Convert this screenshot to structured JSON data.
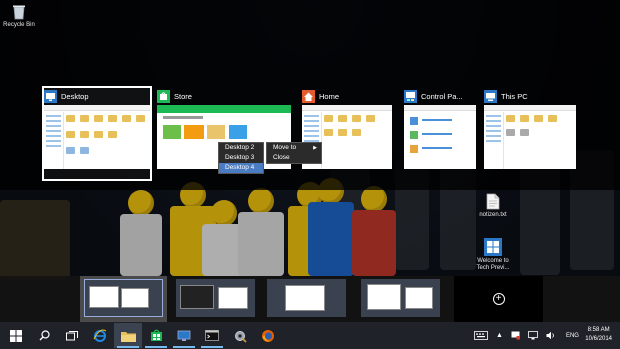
{
  "desktop_icons": [
    {
      "label": "Recycle Bin",
      "icon": "recycle-bin-icon"
    },
    {
      "label": "notizen.txt",
      "icon": "text-file-icon"
    },
    {
      "label": "Welcome to Tech Previ...",
      "icon": "windows-logo-icon"
    }
  ],
  "task_view": {
    "windows": [
      {
        "title": "Desktop",
        "icon": "desktop-icon",
        "selected": true
      },
      {
        "title": "Store",
        "icon": "store-icon",
        "selected": false
      },
      {
        "title": "Home",
        "icon": "home-icon",
        "selected": false
      },
      {
        "title": "Control Pa...",
        "icon": "control-panel-icon",
        "selected": false
      },
      {
        "title": "This PC",
        "icon": "this-pc-icon",
        "selected": false
      }
    ],
    "context_menu": {
      "move_to": "Move to",
      "close": "Close",
      "submenu": [
        "Desktop 2",
        "Desktop 3",
        "Desktop 4"
      ],
      "highlighted": "Desktop 4"
    }
  },
  "virtual_desktops": {
    "count": 4,
    "active_index": 0,
    "add_button": "+"
  },
  "taskbar": {
    "start_icon": "windows-start-icon",
    "search_icon": "search-icon",
    "task_view_icon": "task-view-icon",
    "apps": [
      {
        "name": "internet-explorer-icon"
      },
      {
        "name": "file-explorer-icon"
      },
      {
        "name": "store-icon"
      },
      {
        "name": "remote-desktop-icon"
      },
      {
        "name": "command-prompt-icon"
      },
      {
        "name": "tools-icon"
      },
      {
        "name": "firefox-icon"
      }
    ],
    "tray": {
      "language": "ENG",
      "time": "8:58 AM",
      "date": "10/6/2014"
    }
  },
  "colors": {
    "accent": "#4a7cc4",
    "taskbar": "#1f2228",
    "store_green": "#1db954",
    "ie_blue": "#1e88e5",
    "firefox_orange": "#e66000"
  }
}
